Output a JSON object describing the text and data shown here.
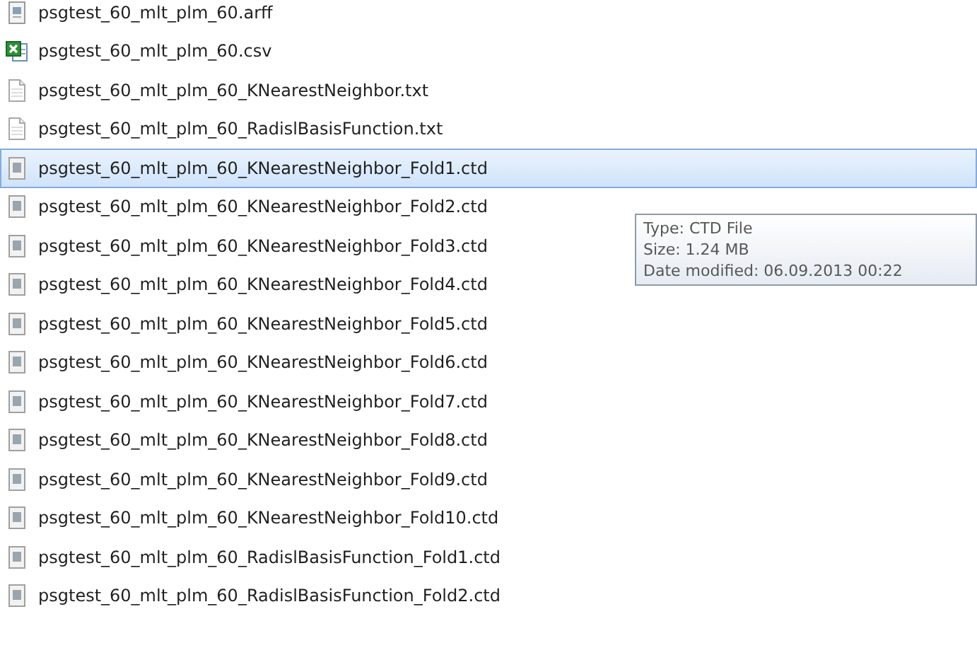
{
  "files": [
    {
      "name": "psgtest_60_mlt_plm_60.arff",
      "kind": "data",
      "selected": false
    },
    {
      "name": "psgtest_60_mlt_plm_60.csv",
      "kind": "spreadsheet",
      "selected": false
    },
    {
      "name": "psgtest_60_mlt_plm_60_KNearestNeighbor.txt",
      "kind": "text",
      "selected": false
    },
    {
      "name": "psgtest_60_mlt_plm_60_RadislBasisFunction.txt",
      "kind": "text",
      "selected": false
    },
    {
      "name": "psgtest_60_mlt_plm_60_KNearestNeighbor_Fold1.ctd",
      "kind": "generic",
      "selected": true
    },
    {
      "name": "psgtest_60_mlt_plm_60_KNearestNeighbor_Fold2.ctd",
      "kind": "generic",
      "selected": false
    },
    {
      "name": "psgtest_60_mlt_plm_60_KNearestNeighbor_Fold3.ctd",
      "kind": "generic",
      "selected": false
    },
    {
      "name": "psgtest_60_mlt_plm_60_KNearestNeighbor_Fold4.ctd",
      "kind": "generic",
      "selected": false
    },
    {
      "name": "psgtest_60_mlt_plm_60_KNearestNeighbor_Fold5.ctd",
      "kind": "generic",
      "selected": false
    },
    {
      "name": "psgtest_60_mlt_plm_60_KNearestNeighbor_Fold6.ctd",
      "kind": "generic",
      "selected": false
    },
    {
      "name": "psgtest_60_mlt_plm_60_KNearestNeighbor_Fold7.ctd",
      "kind": "generic",
      "selected": false
    },
    {
      "name": "psgtest_60_mlt_plm_60_KNearestNeighbor_Fold8.ctd",
      "kind": "generic",
      "selected": false
    },
    {
      "name": "psgtest_60_mlt_plm_60_KNearestNeighbor_Fold9.ctd",
      "kind": "generic",
      "selected": false
    },
    {
      "name": "psgtest_60_mlt_plm_60_KNearestNeighbor_Fold10.ctd",
      "kind": "generic",
      "selected": false
    },
    {
      "name": "psgtest_60_mlt_plm_60_RadislBasisFunction_Fold1.ctd",
      "kind": "generic",
      "selected": false
    },
    {
      "name": "psgtest_60_mlt_plm_60_RadislBasisFunction_Fold2.ctd",
      "kind": "generic",
      "selected": false
    }
  ],
  "tooltip": {
    "lines": [
      "Type: CTD File",
      "Size: 1.24 MB",
      "Date modified: 06.09.2013 00:22"
    ]
  }
}
